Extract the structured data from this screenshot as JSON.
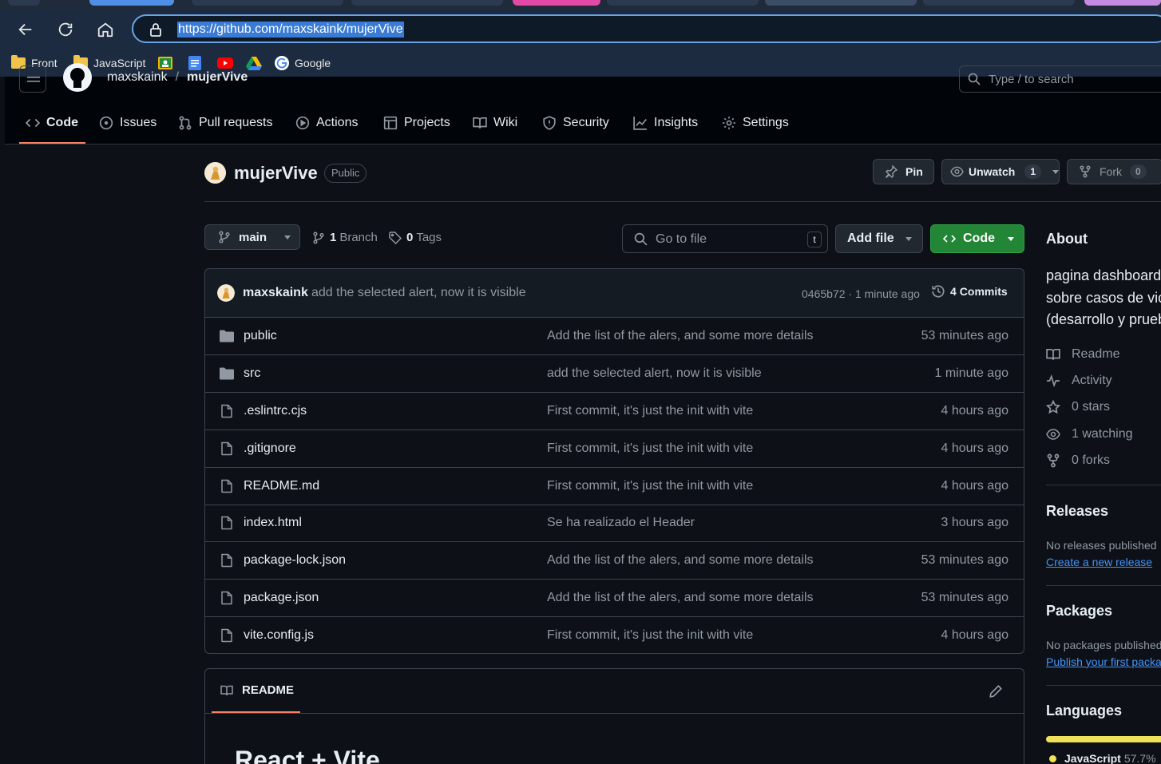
{
  "browser": {
    "url": "https://github.com/maxskaink/mujerVive",
    "bookmarks": [
      {
        "label": "Front",
        "icon": "folder-icon"
      },
      {
        "label": "JavaScript",
        "icon": "folder-icon"
      },
      {
        "label": "",
        "icon": "classroom-icon"
      },
      {
        "label": "",
        "icon": "docs-icon"
      },
      {
        "label": "",
        "icon": "youtube-icon"
      },
      {
        "label": "",
        "icon": "drive-icon"
      },
      {
        "label": "Google",
        "icon": "google-icon"
      }
    ]
  },
  "gh_header": {
    "owner": "maxskaink",
    "separator": "/",
    "repo": "mujerVive",
    "search_placeholder": "Type / to search",
    "tabs": [
      {
        "label": "Code",
        "icon": "code-icon",
        "active": true
      },
      {
        "label": "Issues",
        "icon": "issue-icon"
      },
      {
        "label": "Pull requests",
        "icon": "pull-request-icon"
      },
      {
        "label": "Actions",
        "icon": "play-icon"
      },
      {
        "label": "Projects",
        "icon": "table-icon"
      },
      {
        "label": "Wiki",
        "icon": "book-icon"
      },
      {
        "label": "Security",
        "icon": "shield-icon"
      },
      {
        "label": "Insights",
        "icon": "graph-icon"
      },
      {
        "label": "Settings",
        "icon": "gear-icon"
      }
    ]
  },
  "repo": {
    "name": "mujerVive",
    "visibility": "Public",
    "pin_label": "Pin",
    "unwatch_label": "Unwatch",
    "watch_count": "1",
    "fork_label": "Fork",
    "fork_count": "0"
  },
  "toolbar": {
    "branch": "main",
    "branches_count": "1",
    "branches_label": "Branch",
    "tags_count": "0",
    "tags_label": "Tags",
    "go_to_file_placeholder": "Go to file",
    "go_to_file_key": "t",
    "add_file_label": "Add file",
    "code_label": "Code"
  },
  "latest_commit": {
    "author": "maxskaink",
    "message": "add the selected alert, now it is visible",
    "hash_time": "0465b72 · 1 minute ago",
    "commits_count": "4",
    "commits_label": "Commits"
  },
  "files": [
    {
      "name": "public",
      "type": "folder",
      "message": "Add the list of the alers, and some more details",
      "date": "53 minutes ago"
    },
    {
      "name": "src",
      "type": "folder",
      "message": "add the selected alert, now it is visible",
      "date": "1 minute ago"
    },
    {
      "name": ".eslintrc.cjs",
      "type": "file",
      "message": "First commit, it's just the init with vite",
      "date": "4 hours ago"
    },
    {
      "name": ".gitignore",
      "type": "file",
      "message": "First commit, it's just the init with vite",
      "date": "4 hours ago"
    },
    {
      "name": "README.md",
      "type": "file",
      "message": "First commit, it's just the init with vite",
      "date": "4 hours ago"
    },
    {
      "name": "index.html",
      "type": "file",
      "message": "Se ha realizado el Header",
      "date": "3 hours ago"
    },
    {
      "name": "package-lock.json",
      "type": "file",
      "message": "Add the list of the alers, and some more details",
      "date": "53 minutes ago"
    },
    {
      "name": "package.json",
      "type": "file",
      "message": "Add the list of the alers, and some more details",
      "date": "53 minutes ago"
    },
    {
      "name": "vite.config.js",
      "type": "file",
      "message": "First commit, it's just the init with vite",
      "date": "4 hours ago"
    }
  ],
  "readme": {
    "tab_label": "README",
    "heading": "React + Vite"
  },
  "about": {
    "title": "About",
    "description_lines": [
      "pagina dashboard",
      "sobre casos de vic",
      "(desarrollo y prueb"
    ],
    "items": [
      {
        "label": "Readme",
        "icon": "book-icon"
      },
      {
        "label": "Activity",
        "icon": "pulse-icon"
      },
      {
        "label": "0 stars",
        "icon": "star-icon"
      },
      {
        "label": "1 watching",
        "icon": "eye-icon"
      },
      {
        "label": "0 forks",
        "icon": "fork-icon"
      }
    ]
  },
  "releases": {
    "title": "Releases",
    "empty_text": "No releases published",
    "create_link": "Create a new release"
  },
  "packages": {
    "title": "Packages",
    "empty_text": "No packages published",
    "publish_link": "Publish your first packag"
  },
  "languages": {
    "title": "Languages",
    "items": [
      {
        "name": "JavaScript",
        "percent": "57.7%",
        "color": "#f1e05a"
      }
    ]
  },
  "colors": {
    "accent_green": "#238636",
    "active_tab_underline": "#f78166",
    "link": "#4493f8"
  }
}
